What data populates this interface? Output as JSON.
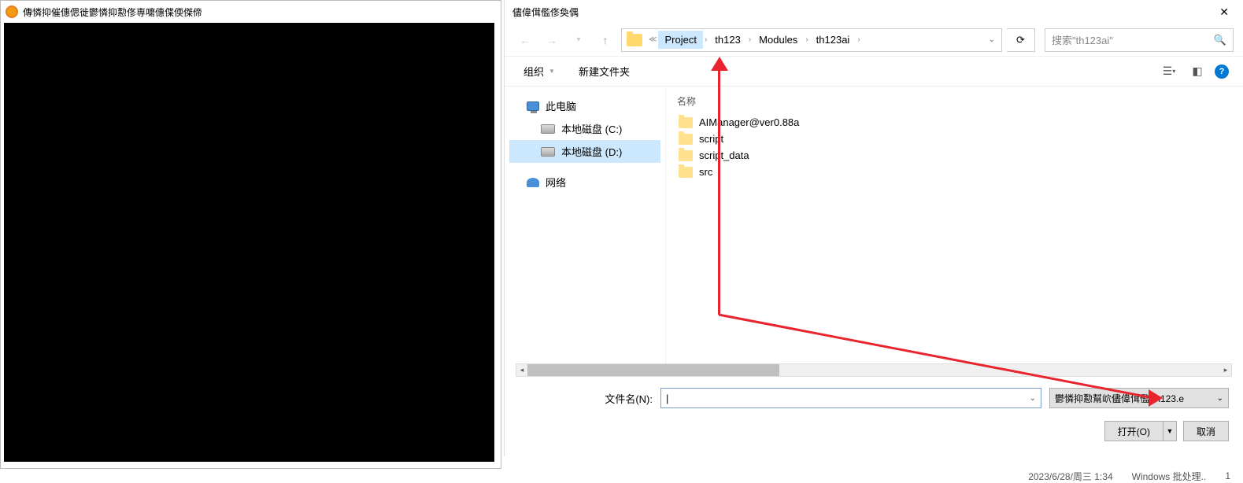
{
  "bg_window": {
    "title": "傳憐抑催僡偲徙鬱憐抑懃俢専嚰僡偞偄傑偙"
  },
  "dialog": {
    "title": "儘偉傇儖俢奐偶",
    "nav": {
      "breadcrumbs": [
        "Project",
        "th123",
        "Modules",
        "th123ai"
      ],
      "search_placeholder": "搜索\"th123ai\""
    },
    "toolbar": {
      "organize": "组织",
      "new_folder": "新建文件夹"
    },
    "tree": {
      "pc": "此电脑",
      "disk_c": "本地磁盘 (C:)",
      "disk_d": "本地磁盘 (D:)",
      "network": "网络"
    },
    "files": {
      "col_name": "名称",
      "items": [
        "AIManager@ver0.88a",
        "script",
        "script_data",
        "src"
      ]
    },
    "filename_label": "文件名(N):",
    "filetype": "鬱憐抑懃幫岤儘偉傇儖(th123.e",
    "open_btn": "打开(O)",
    "cancel_btn": "取消"
  },
  "taskbar": {
    "datetime": "2023/6/28/周三 1:34",
    "task": "Windows 批处理..",
    "count": "1"
  }
}
